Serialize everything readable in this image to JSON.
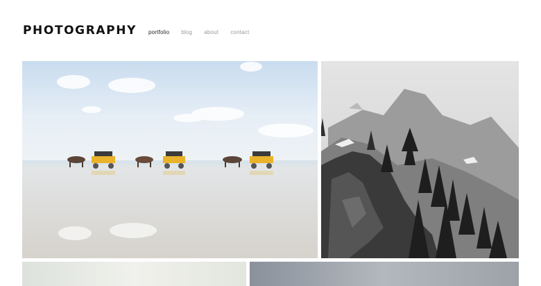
{
  "header": {
    "logo": "PHOTOGRAPHY",
    "nav": [
      {
        "label": "portfolio",
        "active": true
      },
      {
        "label": "blog",
        "active": false
      },
      {
        "label": "about",
        "active": false
      },
      {
        "label": "contact",
        "active": false
      }
    ]
  },
  "gallery": {
    "tiles": [
      {
        "subject": "horse-drawn carriages crossing tidal flats"
      },
      {
        "subject": "black and white mountain cliff with pine trees"
      },
      {
        "subject": "pale sky photo (partially visible)"
      },
      {
        "subject": "grey sky photo (partially visible)"
      }
    ]
  },
  "colors": {
    "text": "#111111",
    "nav_inactive": "#9a9a9a",
    "nav_active": "#222222",
    "carriage_yellow": "#e8b22a"
  }
}
